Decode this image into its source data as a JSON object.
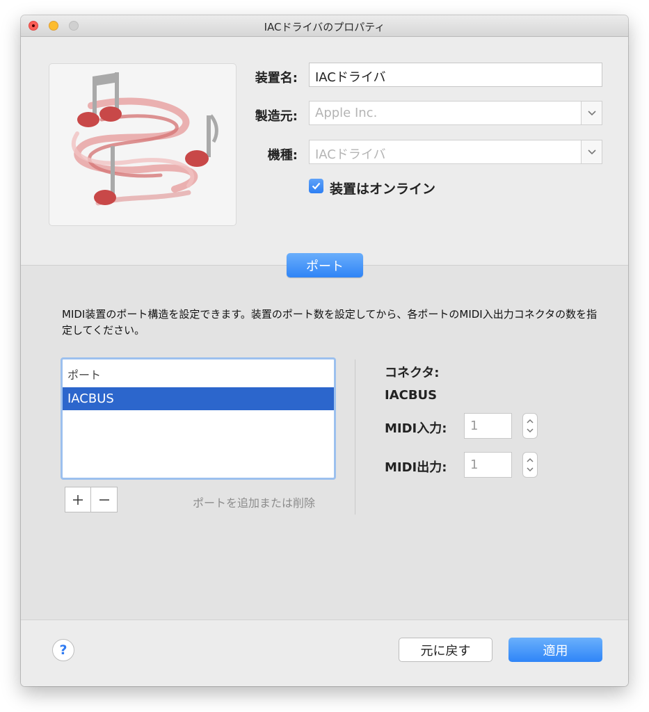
{
  "window": {
    "title": "IACドライバのプロパティ"
  },
  "device": {
    "name_label": "装置名:",
    "name_value": "IACドライバ",
    "manufacturer_label": "製造元:",
    "manufacturer_value": "Apple Inc.",
    "model_label": "機種:",
    "model_value": "IACドライバ",
    "online_label": "装置はオンライン",
    "online_checked": true,
    "icon": "midi-music-notes-icon"
  },
  "tabs": {
    "ports_label": "ポート"
  },
  "ports_section": {
    "description": "MIDI装置のポート構造を設定できます。装置のポート数を設定してから、各ポートのMIDI入出力コネクタの数を指定してください。",
    "list_header": "ポート",
    "ports": [
      "IACBUS"
    ],
    "selected_port": "IACBUS",
    "add_remove_hint": "ポートを追加または削除"
  },
  "connectors": {
    "title": "コネクタ:",
    "port_name": "IACBUS",
    "midi_in_label": "MIDI入力:",
    "midi_in_value": "1",
    "midi_out_label": "MIDI出力:",
    "midi_out_value": "1"
  },
  "footer": {
    "help_symbol": "?",
    "revert_label": "元に戻す",
    "apply_label": "適用"
  },
  "colors": {
    "accent": "#2f84f6",
    "selection": "#2c66cc",
    "close": "#fc5f57",
    "minimize": "#fdbc2e"
  }
}
